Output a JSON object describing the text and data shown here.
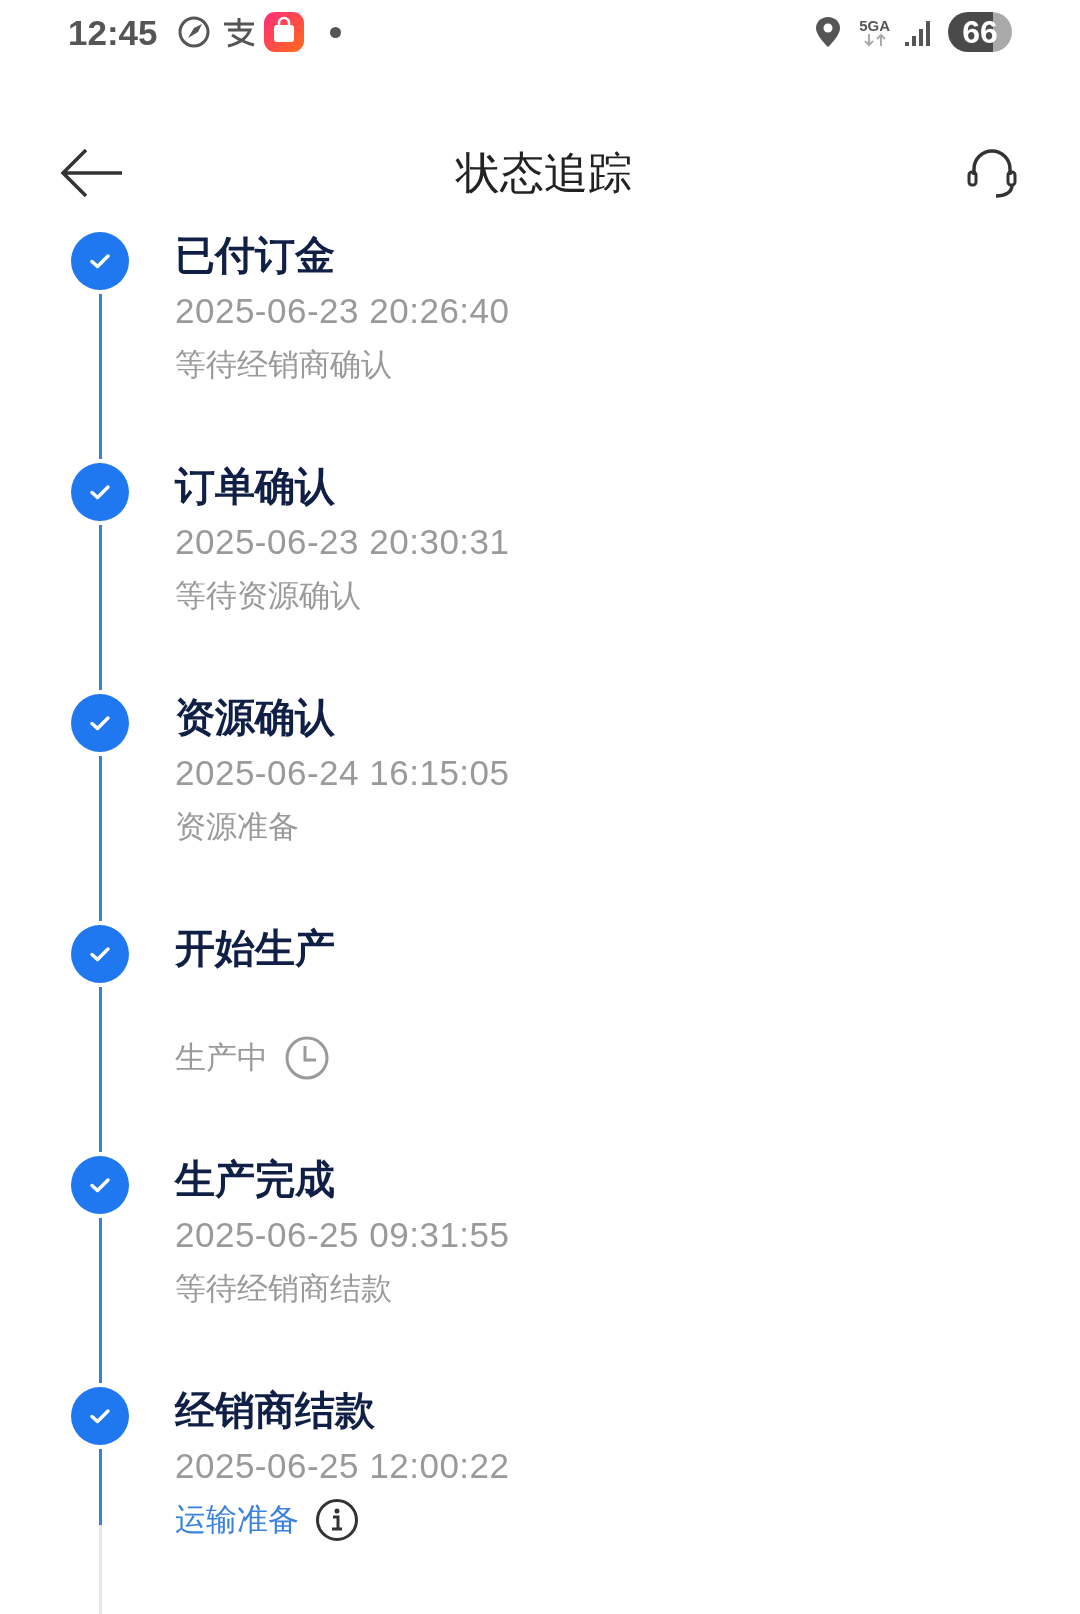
{
  "status_bar": {
    "time": "12:45",
    "network": "5GA",
    "battery": "66"
  },
  "header": {
    "title": "状态追踪"
  },
  "steps": [
    {
      "title": "已付订金",
      "time": "2025-06-23 20:26:40",
      "note": "等待经销商确认",
      "kind": "plain",
      "done": true
    },
    {
      "title": "订单确认",
      "time": "2025-06-23 20:30:31",
      "note": "等待资源确认",
      "kind": "plain",
      "done": true
    },
    {
      "title": "资源确认",
      "time": "2025-06-24 16:15:05",
      "note": "资源准备",
      "kind": "plain",
      "done": true
    },
    {
      "title": "开始生产",
      "note": "生产中",
      "kind": "pending",
      "done": true
    },
    {
      "title": "生产完成",
      "time": "2025-06-25 09:31:55",
      "note": "等待经销商结款",
      "kind": "plain",
      "done": true
    },
    {
      "title": "经销商结款",
      "time": "2025-06-25 12:00:22",
      "note": "运输准备",
      "kind": "current",
      "done": true
    }
  ]
}
